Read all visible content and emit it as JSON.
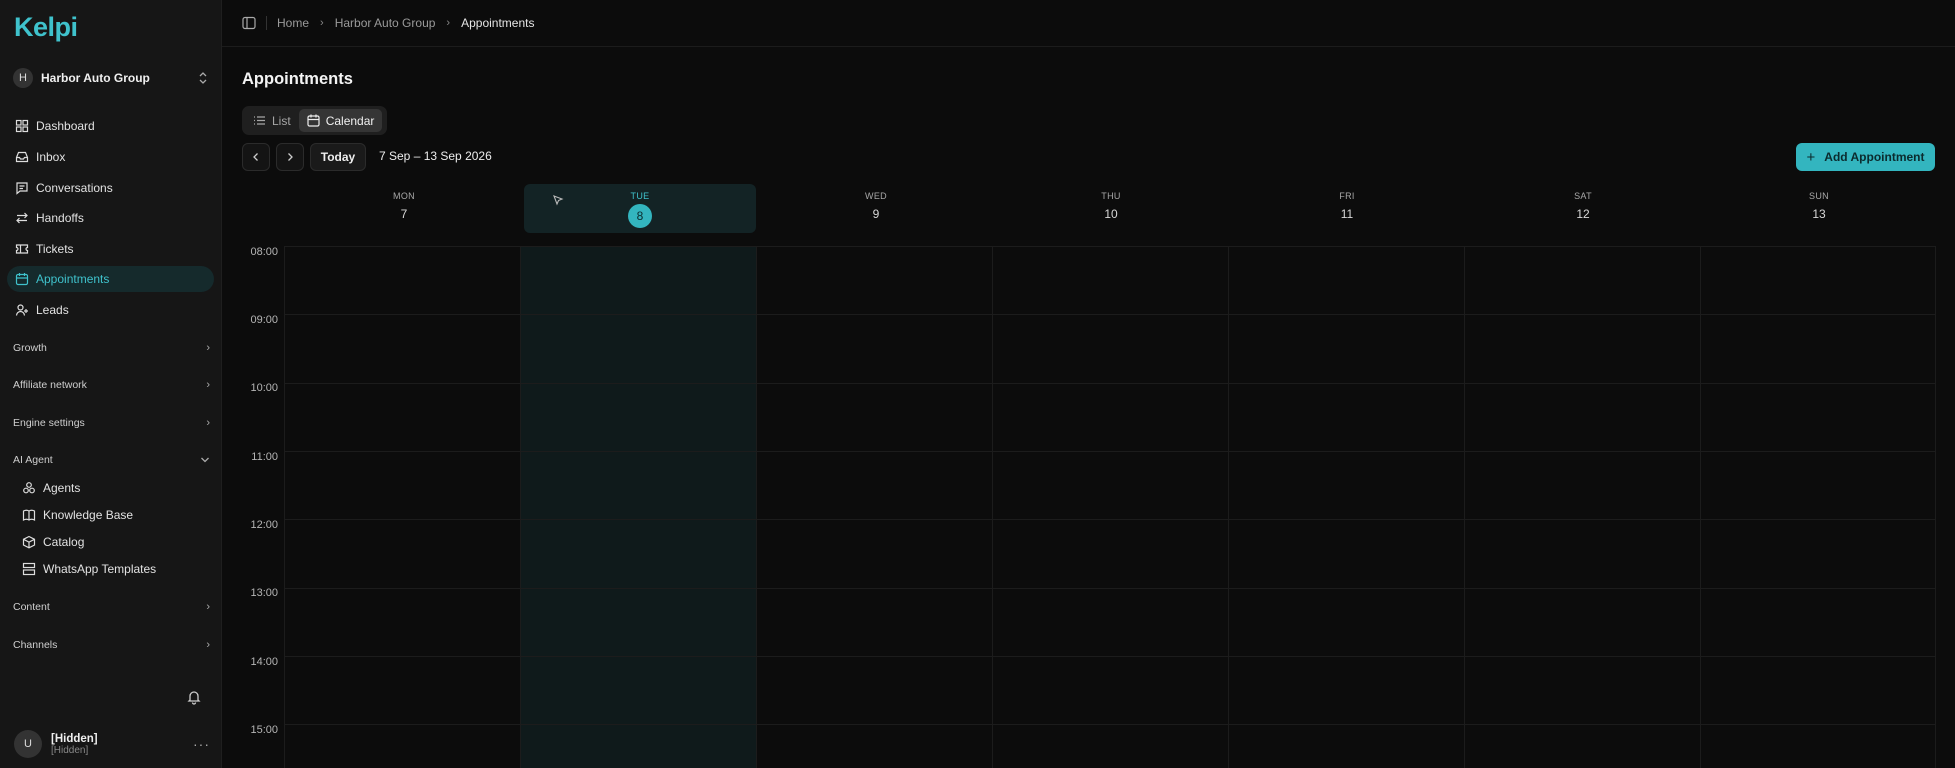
{
  "app": {
    "logo": "Kelpi"
  },
  "org": {
    "initial": "H",
    "name": "Harbor Auto Group"
  },
  "sidebar": {
    "items": [
      {
        "label": "Dashboard",
        "icon": "dashboard-icon"
      },
      {
        "label": "Inbox",
        "icon": "inbox-icon"
      },
      {
        "label": "Conversations",
        "icon": "message-square-icon"
      },
      {
        "label": "Handoffs",
        "icon": "arrows-swap-icon"
      },
      {
        "label": "Tickets",
        "icon": "ticket-icon"
      },
      {
        "label": "Appointments",
        "icon": "calendar-icon",
        "active": true
      },
      {
        "label": "Leads",
        "icon": "user-plus-icon"
      }
    ],
    "groups": {
      "growth": "Growth",
      "affiliate": "Affiliate network",
      "engine": "Engine settings",
      "ai_agent": "AI Agent",
      "content": "Content",
      "channels": "Channels"
    },
    "ai_items": [
      {
        "label": "Agents",
        "icon": "bot-icon"
      },
      {
        "label": "Knowledge Base",
        "icon": "book-icon"
      },
      {
        "label": "Catalog",
        "icon": "package-icon"
      },
      {
        "label": "WhatsApp Templates",
        "icon": "template-icon"
      }
    ]
  },
  "user": {
    "initial": "U",
    "name": "[Hidden]",
    "email": "[Hidden]"
  },
  "breadcrumb": {
    "home": "Home",
    "org": "Harbor Auto Group",
    "current": "Appointments"
  },
  "page": {
    "title": "Appointments",
    "view_list": "List",
    "view_calendar": "Calendar",
    "today": "Today",
    "range": "7 Sep – 13 Sep 2026",
    "add": "Add Appointment"
  },
  "calendar": {
    "days": [
      {
        "dow": "MON",
        "num": "7"
      },
      {
        "dow": "TUE",
        "num": "8",
        "today": true
      },
      {
        "dow": "WED",
        "num": "9"
      },
      {
        "dow": "THU",
        "num": "10"
      },
      {
        "dow": "FRI",
        "num": "11"
      },
      {
        "dow": "SAT",
        "num": "12"
      },
      {
        "dow": "SUN",
        "num": "13"
      }
    ],
    "hours": [
      "08:00",
      "09:00",
      "10:00",
      "11:00",
      "12:00",
      "13:00",
      "14:00",
      "15:00"
    ]
  },
  "colors": {
    "accent": "#33b5bf",
    "background": "#0c0c0c",
    "sidebar": "#161616"
  }
}
